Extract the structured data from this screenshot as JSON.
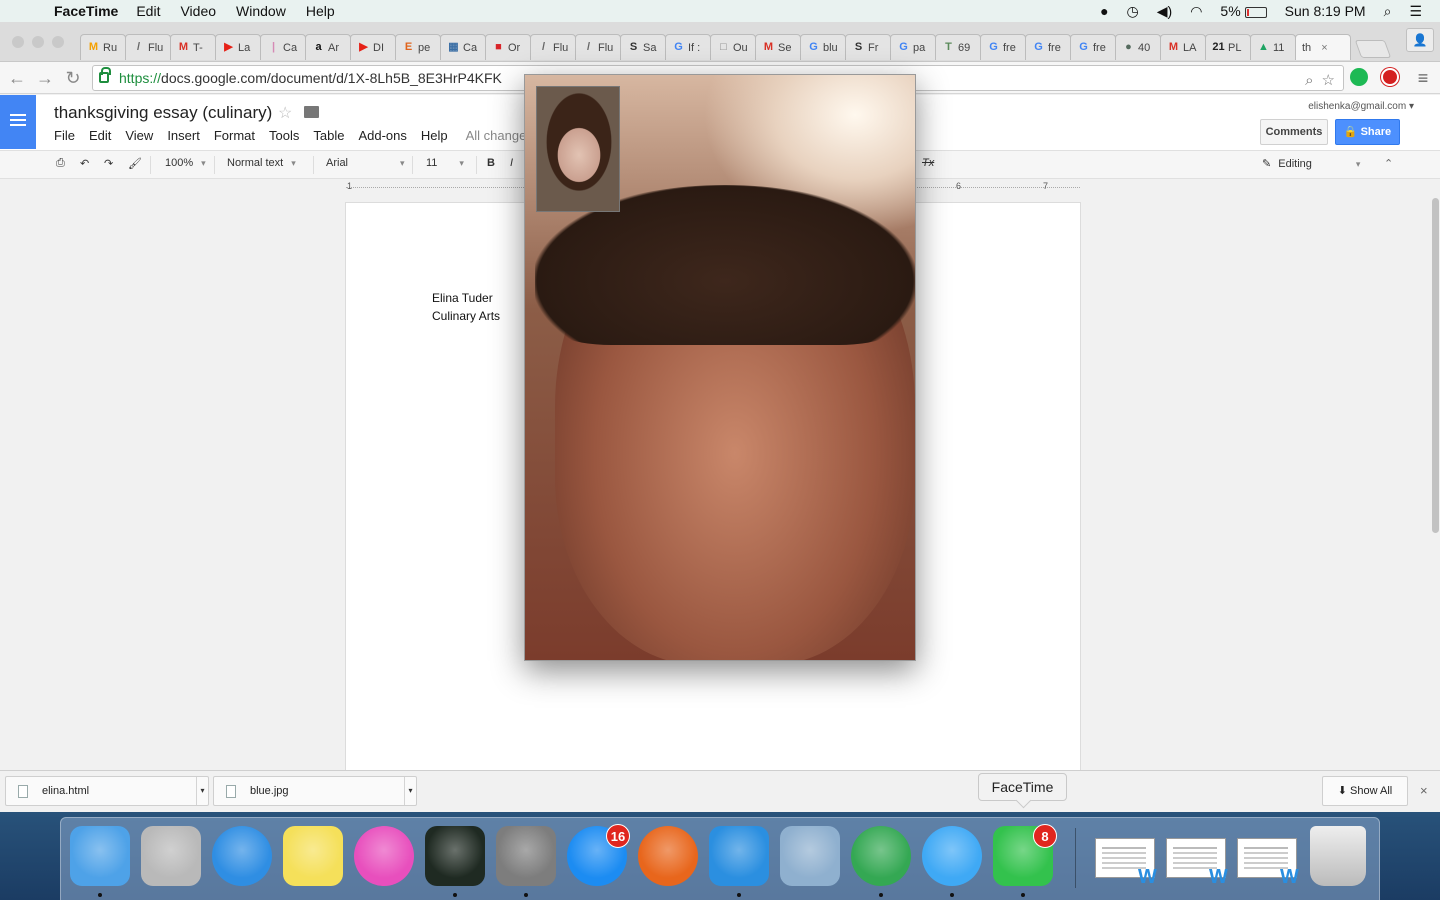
{
  "menubar": {
    "app_name": "FaceTime",
    "items": [
      "Edit",
      "Video",
      "Window",
      "Help"
    ],
    "battery": "5%",
    "clock": "Sun 8:19 PM"
  },
  "tabs": [
    {
      "label": "Ru",
      "fav": "M",
      "color": "#f4a000"
    },
    {
      "label": "Flu",
      "fav": "/",
      "color": "#666666"
    },
    {
      "label": "T-",
      "fav": "M",
      "color": "#d93025"
    },
    {
      "label": "La",
      "fav": "▶",
      "color": "#e62117"
    },
    {
      "label": "Ca",
      "fav": "|",
      "color": "#d68ab5"
    },
    {
      "label": "Ar",
      "fav": "a",
      "color": "#111111"
    },
    {
      "label": "DI",
      "fav": "▶",
      "color": "#e62117"
    },
    {
      "label": "pe",
      "fav": "E",
      "color": "#e0641c"
    },
    {
      "label": "Ca",
      "fav": "▦",
      "color": "#3a6ea5"
    },
    {
      "label": "Or",
      "fav": "■",
      "color": "#d9252a"
    },
    {
      "label": "Flu",
      "fav": "/",
      "color": "#666666"
    },
    {
      "label": "Flu",
      "fav": "/",
      "color": "#666666"
    },
    {
      "label": "Sa",
      "fav": "S",
      "color": "#333333"
    },
    {
      "label": "If :",
      "fav": "G",
      "color": "#4285f4"
    },
    {
      "label": "Ou",
      "fav": "□",
      "color": "#888888"
    },
    {
      "label": "Se",
      "fav": "M",
      "color": "#d93025"
    },
    {
      "label": "blu",
      "fav": "G",
      "color": "#4285f4"
    },
    {
      "label": "Fr",
      "fav": "S",
      "color": "#333333"
    },
    {
      "label": "pa",
      "fav": "G",
      "color": "#4285f4"
    },
    {
      "label": "69",
      "fav": "T",
      "color": "#5a8a5a"
    },
    {
      "label": "fre",
      "fav": "G",
      "color": "#4285f4"
    },
    {
      "label": "fre",
      "fav": "G",
      "color": "#4285f4"
    },
    {
      "label": "fre",
      "fav": "G",
      "color": "#4285f4"
    },
    {
      "label": "40",
      "fav": "●",
      "color": "#556b5e"
    },
    {
      "label": "LA",
      "fav": "M",
      "color": "#d93025"
    },
    {
      "label": "PL",
      "fav": "21",
      "color": "#222222"
    },
    {
      "label": "11",
      "fav": "▲",
      "color": "#1fa463"
    }
  ],
  "active_tab": {
    "label": "th",
    "close": "×"
  },
  "address": {
    "scheme": "https://",
    "rest": "docs.google.com/document/d/1X-8Lh5B_8E3HrP4KFK"
  },
  "docs": {
    "title": "thanksgiving essay (culinary)",
    "menu": [
      "File",
      "Edit",
      "View",
      "Insert",
      "Format",
      "Tools",
      "Table",
      "Add-ons",
      "Help"
    ],
    "saved_status": "All changes sa",
    "account": "elishenka@gmail.com",
    "comments_label": "Comments",
    "share_label": "Share",
    "toolbar": {
      "zoom": "100%",
      "style": "Normal text",
      "font": "Arial",
      "size": "11",
      "bold": "B",
      "italic": "I",
      "clear_format": "Tx",
      "editing": "Editing"
    },
    "ruler": [
      "1",
      "6",
      "7"
    ],
    "body_lines": [
      "Elina Tuder",
      "Culinary Arts"
    ]
  },
  "downloads": {
    "items": [
      "elina.html",
      "blue.jpg"
    ],
    "show_all": "Show All",
    "close": "×"
  },
  "tooltip": "FaceTime",
  "dock": {
    "badges": {
      "app_store": "16",
      "facetime": "8"
    },
    "icons": [
      {
        "name": "finder-icon",
        "color": "#4ea2e8"
      },
      {
        "name": "calculator-icon",
        "color": "#b9b9b9"
      },
      {
        "name": "safari-icon",
        "color": "#2f8ee3"
      },
      {
        "name": "notes-icon",
        "color": "#f5e05a"
      },
      {
        "name": "itunes-icon",
        "color": "#e84fbd"
      },
      {
        "name": "activity-monitor-icon",
        "color": "#1f2a22"
      },
      {
        "name": "system-preferences-icon",
        "color": "#7d7d7d"
      },
      {
        "name": "app-store-icon",
        "color": "#1c8cf2"
      },
      {
        "name": "firefox-icon",
        "color": "#e8661c"
      },
      {
        "name": "word-icon",
        "color": "#2b8fe0"
      },
      {
        "name": "preview-icon",
        "color": "#8fb0cf"
      },
      {
        "name": "chrome-icon",
        "color": "#34a853"
      },
      {
        "name": "messages-icon",
        "color": "#3fa9f5"
      },
      {
        "name": "facetime-icon",
        "color": "#33c24d"
      }
    ]
  }
}
